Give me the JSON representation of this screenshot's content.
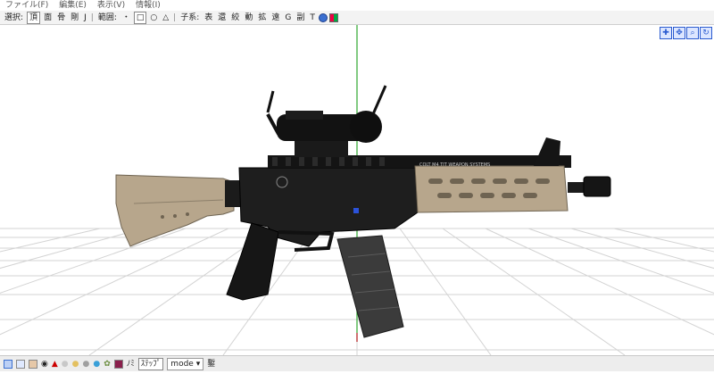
{
  "menu": [
    {
      "label": "ファイル(F)"
    },
    {
      "label": "編集(E)"
    },
    {
      "label": "表示(V)"
    },
    {
      "label": "情報(I)"
    }
  ],
  "toolbar": {
    "select_label": "選択:",
    "select_items": [
      "頂",
      "面",
      "骨",
      "剛",
      "J"
    ],
    "range_label": "範囲:",
    "range_items": [
      "・",
      "□",
      "○",
      "△"
    ],
    "parent_label": "子系:",
    "parent_items": [
      "表",
      "還",
      "絞",
      "動",
      "拡",
      "遠",
      "G",
      "副",
      "T"
    ]
  },
  "nav_icons": [
    "axis-move-icon",
    "pan-icon",
    "zoom-icon",
    "rotate-icon"
  ],
  "statusbar": {
    "items": [
      "",
      "",
      "",
      "",
      "",
      "",
      "",
      "",
      "",
      "",
      "",
      ""
    ],
    "label_no": "ﾉﾐ",
    "step_label": "ｽﾃｯﾌﾟ",
    "mode_label": "mode",
    "end_label": "鏨"
  },
  "colors": {
    "gun_black": "#1b1b1b",
    "gun_tan": "#b7a68c",
    "y_axis": "#2fa82f",
    "x_axis": "#c23",
    "grid": "#d0d0d0"
  },
  "weapon": {
    "marking_1": "COLT M4 TIT WEAPON SYSTEMS"
  }
}
